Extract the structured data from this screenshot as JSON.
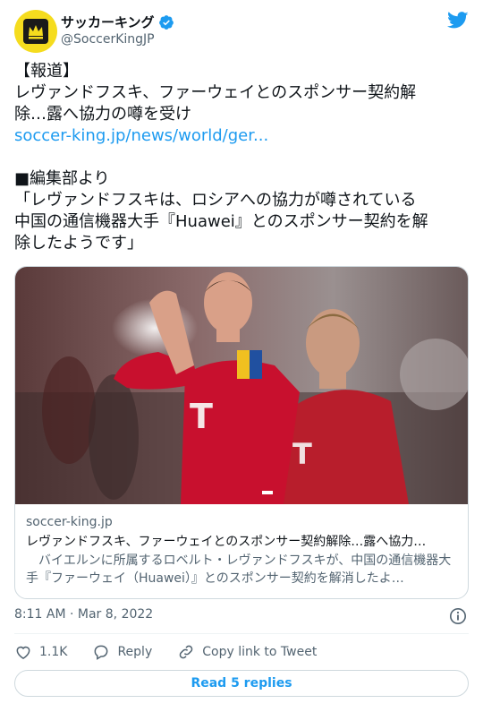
{
  "author": {
    "display_name": "サッカーキング",
    "handle": "@SoccerKingJP",
    "verified": true,
    "avatar_color": "#f5dc1e"
  },
  "tweet": {
    "lines": [
      "【報道】",
      "レヴァンドフスキ、ファーウェイとのスポンサー契約解",
      "除…露へ協力の噂を受け"
    ],
    "link_text": "soccer-king.jp/news/world/ger...",
    "lines2": [
      "■編集部より",
      "「レヴァンドフスキは、ロシアへの協力が噂されている",
      "中国の通信機器大手『Huawei』とのスポンサー契約を解",
      "除したようです」"
    ]
  },
  "link_card": {
    "domain": "soccer-king.jp",
    "title": "レヴァンドフスキ、ファーウェイとのスポンサー契約解除…露へ協力…",
    "description": "　バイエルンに所属するロベルト・レヴァンドフスキが、中国の通信機器大手『ファーウェイ（Huawei）』とのスポンサー契約を解消したよ…"
  },
  "timestamp": "8:11 AM · Mar 8, 2022",
  "actions": {
    "like_count": "1.1K",
    "reply_label": "Reply",
    "copy_label": "Copy link to Tweet"
  },
  "replies_button": "Read 5 replies",
  "colors": {
    "accent": "#1d9bf0",
    "text": "#0f1419",
    "secondary": "#536471",
    "jersey_red": "#c8102e"
  }
}
